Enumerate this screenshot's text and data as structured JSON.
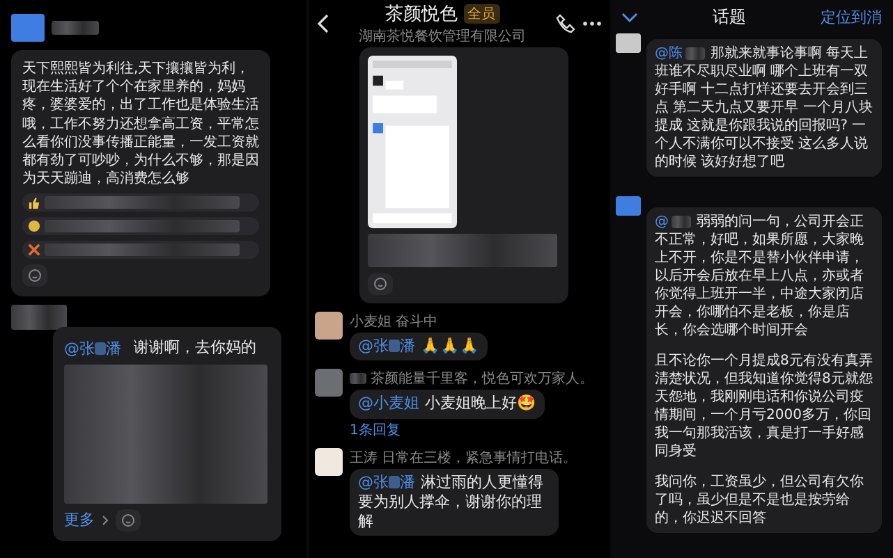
{
  "left_chat": {
    "post_text": "天下熙熙皆为利往,天下攘攘皆为利，现在生活好了个个在家里养的，妈妈疼，婆婆爱的，出了工作也是体验生活哦，工作不努力还想拿高工资，平常怎么看你们没事传播正能量，一发工资就都有劲了可吵吵，为什么不够，那是因为天天蹦迪，高消费怎么够",
    "reply": {
      "mention_start": "@张",
      "mention_end": "潘",
      "text": "谢谢啊，去你妈的",
      "more_link": "更多"
    }
  },
  "group_chat": {
    "header": {
      "title": "茶颜悦色",
      "badge": "全员",
      "subtitle": "湖南茶悦餐饮管理有限公司"
    },
    "messages": [
      {
        "sender": "小麦姐",
        "status": "奋斗中",
        "mention_start": "@张",
        "mention_end": "潘",
        "text": "🙏🙏🙏"
      },
      {
        "status": "茶颜能量千里客，悦色可欢万家人。",
        "mention_start": "@小麦姐",
        "text": "小麦姐晚上好🤩",
        "replies": "1条回复"
      },
      {
        "sender": "王涛",
        "status": "日常在三楼，紧急事情打电话。",
        "mention_start": "@张",
        "mention_end": "潘",
        "text": "淋过雨的人更懂得要为别人撑伞，谢谢你的理解"
      }
    ]
  },
  "topic_chat": {
    "header": {
      "title": "话题",
      "locate_link": "定位到消"
    },
    "messages": [
      {
        "mention_start": "@陈",
        "paragraphs": [
          "那就来就事论事啊 每天上班谁不尽职尽业啊 哪个上班有一双好手啊 十二点打烊还要去开会到三点 第二天九点又要开早 一个月八块提成 这就是你跟我说的回报吗? 一个人不满你可以不接受 这么多人说的时候 该好好想了吧"
        ]
      },
      {
        "mention_start": "@",
        "paragraphs": [
          "弱弱的问一句，公司开会正不正常，好吧，如果所愿，大家晚上不开，你是不是替小伙伴申请，以后开会后放在早上八点，亦或者你觉得上班开一半，中途大家闭店开会，你哪怕不是老板，你是店长，你会选哪个时间开会",
          "且不论你一个月提成8元有没有真弄清楚状况，但我知道你觉得8元就怨天怨地，我刚刚电话和你说公司疫情期间，一个月亏2000多万，你回我一句那我活该，真是打一手好感同身受",
          "我问你，工资虽少，但公司有欠你了吗，虽少但是不是也是按劳给的，你迟迟不回答"
        ]
      }
    ]
  }
}
